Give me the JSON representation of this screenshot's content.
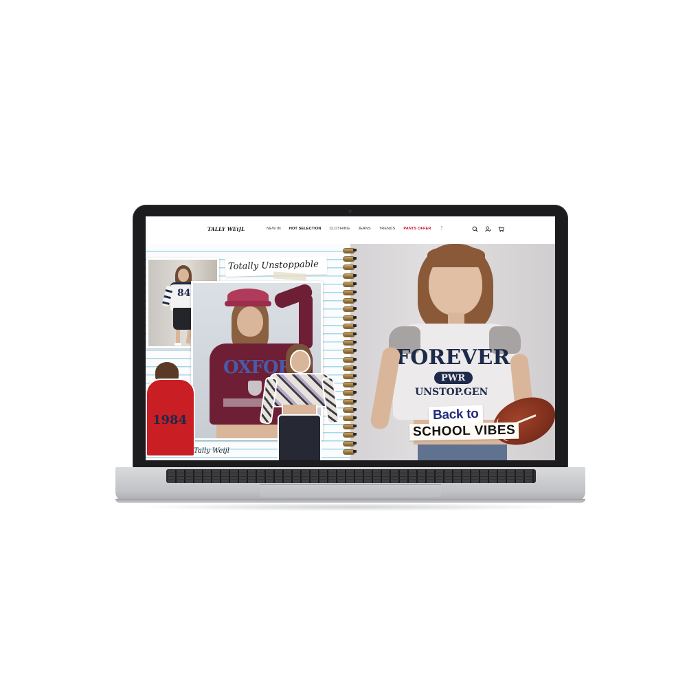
{
  "header": {
    "logo": "TALLY WEiJL",
    "nav": [
      {
        "label": "NEW IN",
        "style": "normal"
      },
      {
        "label": "HOT SELECTION",
        "style": "bold"
      },
      {
        "label": "CLOTHING",
        "style": "normal"
      },
      {
        "label": "JEANS",
        "style": "normal"
      },
      {
        "label": "TRENDS",
        "style": "normal"
      },
      {
        "label": "PANTS OFFER",
        "style": "offer"
      }
    ],
    "more_icon": "kebab-menu-icon",
    "icons": [
      "search-icon",
      "account-icon",
      "cart-icon"
    ]
  },
  "hero": {
    "script_title": "Totally Unstoppable",
    "signature": "Tally Weijl",
    "tee_print": {
      "line1": "FOREVER",
      "badge": "PWR",
      "line2": "UNSTOP.GEN"
    },
    "sweatshirt_print": "OXFORD",
    "hoodie_print": "1984",
    "jersey_number": "84",
    "promo_line1": "Back to",
    "promo_line2": "SCHOOL VIBES"
  },
  "colors": {
    "accent_offer": "#c8102e",
    "promo_blue": "#232b7a",
    "sweatshirt": "#6e1f35",
    "hoodie": "#c81e24"
  }
}
